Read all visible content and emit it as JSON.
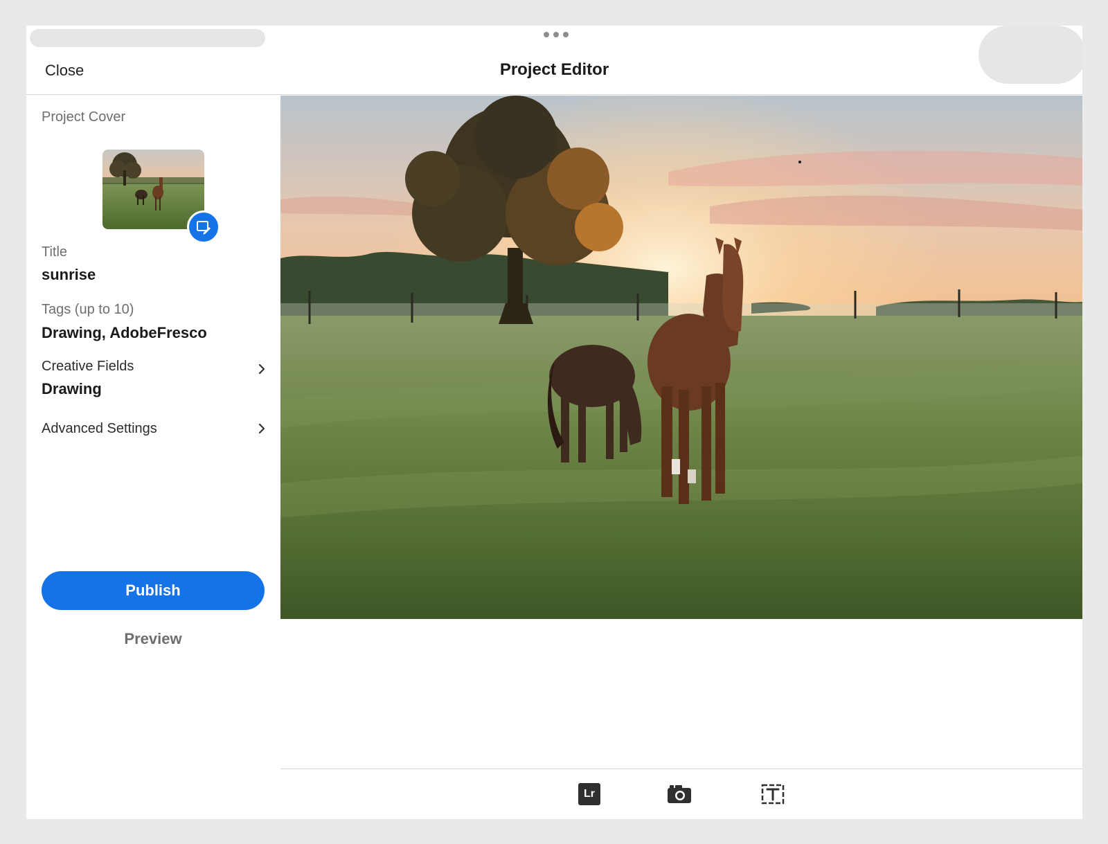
{
  "header": {
    "close_label": "Close",
    "title": "Project Editor"
  },
  "sidebar": {
    "cover_label": "Project Cover",
    "title_label": "Title",
    "title_value": "sunrise",
    "tags_label": "Tags (up to 10)",
    "tags_value": "Drawing, AdobeFresco",
    "creative_fields_label": "Creative Fields",
    "creative_fields_value": "Drawing",
    "advanced_settings_label": "Advanced Settings",
    "publish_label": "Publish",
    "preview_label": "Preview"
  },
  "toolbar": {
    "lightroom_label": "Lr",
    "icons": [
      "lightroom-icon",
      "camera-icon",
      "text-icon"
    ]
  },
  "colors": {
    "accent": "#1473e6",
    "sky_top": "#b9c6d4",
    "sunset": "#f6b36b",
    "grass": "#5e7a3a"
  }
}
